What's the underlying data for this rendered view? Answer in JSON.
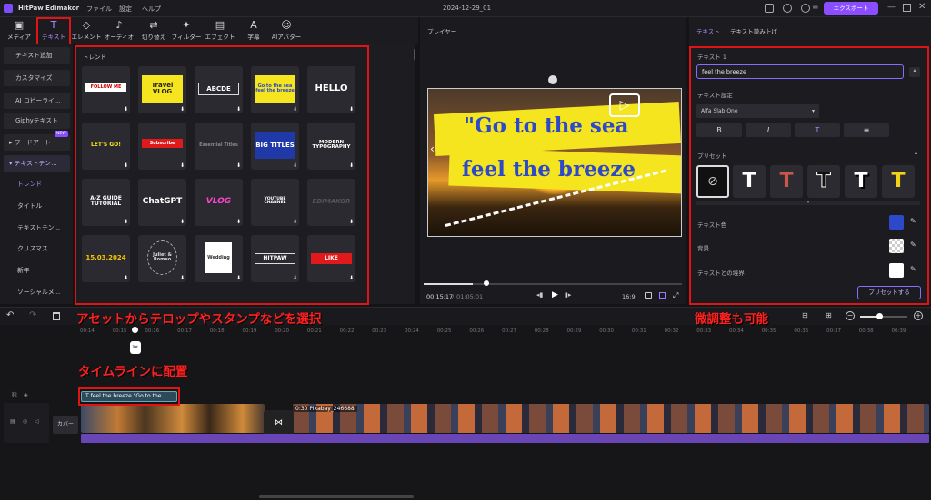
{
  "titlebar": {
    "app": "HitPaw Edimakor",
    "menu": [
      "ファイル",
      "設定",
      "ヘルプ"
    ],
    "project": "2024-12-29_01",
    "export": "エクスポート"
  },
  "toolbar": {
    "items": [
      {
        "label": "メディア",
        "icon": "media-icon"
      },
      {
        "label": "テキスト",
        "icon": "text-icon"
      },
      {
        "label": "エレメント",
        "icon": "elements-icon"
      },
      {
        "label": "オーディオ",
        "icon": "audio-icon"
      },
      {
        "label": "切り替え",
        "icon": "transition-icon"
      },
      {
        "label": "フィルター",
        "icon": "filter-icon"
      },
      {
        "label": "エフェクト",
        "icon": "effect-icon"
      },
      {
        "label": "字幕",
        "icon": "subtitle-icon"
      },
      {
        "label": "AIアバター",
        "icon": "avatar-icon"
      }
    ]
  },
  "sidebar": {
    "items": [
      "テキスト追加",
      "カスタマイズ",
      "AI コピーライ...",
      "Giphyテキスト",
      "ワードアート",
      "テキストテン...",
      "トレンド",
      "タイトル",
      "テキストテン...",
      "クリスマス",
      "新年",
      "ソーシャルメ..."
    ],
    "new_badge": "NEW"
  },
  "grid": {
    "title": "トレンド",
    "cards": [
      "FOLLOW ME",
      "Travel VLOG",
      "ABCDE",
      "Go to the sea feel the breeze",
      "HELLO",
      "LET'S GO!",
      "Subscribe",
      "Essential Titles",
      "BIG TITLES",
      "MODERN TYPOGRAPHY",
      "A-Z GUIDE TUTORIAL",
      "ChatGPT",
      "VLOG",
      "YOUTUBE CHANNEL",
      "EDIMAKOR",
      "15.03.2024",
      "Juliet & Romeo",
      "Wedding",
      "HITPAW",
      "LIKE"
    ]
  },
  "player": {
    "title": "プレイヤー",
    "line1": "\"Go to the sea",
    "line2": "feel the breeze",
    "time_current": "00:15:17",
    "time_total": "01:05:01",
    "ratio": "16:9",
    "progress": 0.19
  },
  "right": {
    "tabs": [
      "テキスト",
      "テキスト読み上げ"
    ],
    "text_label": "テキスト 1",
    "text_value": "feel the breeze",
    "setting_label": "テキスト設定",
    "font": "Alfa Slab One",
    "format_buttons": [
      "B",
      "I",
      "T",
      "≡"
    ],
    "preset_label": "プリセット",
    "color_label": "テキスト色",
    "bg_label": "背景",
    "border_label": "テキストとの境界",
    "preset_button": "プリセットする",
    "colors": {
      "text": "#2d49c9",
      "border": "#ffffff"
    }
  },
  "timeline": {
    "ticks": [
      "00:14",
      "00:15",
      "00:16",
      "00:17",
      "00:18",
      "00:19",
      "00:20",
      "00:21",
      "00:22",
      "00:23",
      "00:24",
      "00:25",
      "00:26",
      "00:27",
      "00:28",
      "00:29",
      "00:30",
      "00:31",
      "00:32",
      "00:33",
      "00:34",
      "00:35",
      "00:36",
      "00:37",
      "00:38",
      "00:39"
    ],
    "text_clip": "feel the breeze \"Go to the",
    "cover": "カバー",
    "video_clip": "0:30 Pixabay_246688"
  },
  "annotations": {
    "a1": "アセットからテロップやスタンプなどを選択",
    "a2": "微調整も可能",
    "a3": "タイムラインに配置"
  }
}
